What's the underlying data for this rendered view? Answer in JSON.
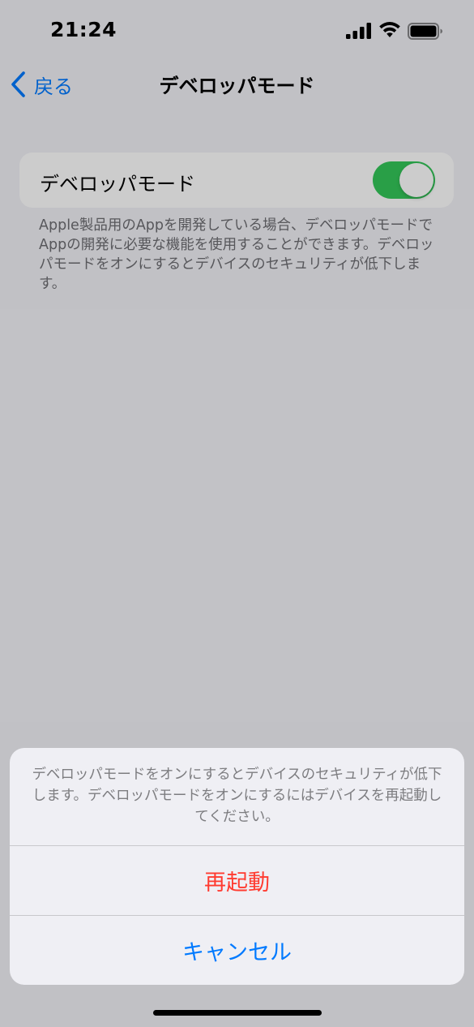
{
  "status_bar": {
    "time": "21:24",
    "icons": [
      "cellular-signal-icon",
      "wifi-icon",
      "battery-icon"
    ]
  },
  "nav": {
    "back_label": "戻る",
    "title": "デベロッパモード"
  },
  "settings": {
    "developer_mode_label": "デベロッパモード",
    "developer_mode_on": true,
    "footer_text": "Apple製品用のAppを開発している場合、デベロッパモードでAppの開発に必要な機能を使用することができます。デベロッパモードをオンにするとデバイスのセキュリティが低下します。"
  },
  "action_sheet": {
    "message": "デベロッパモードをオンにするとデバイスのセキュリティが低下します。デベロッパモードをオンにするにはデバイスを再起動してください。",
    "restart_label": "再起動",
    "cancel_label": "キャンセル"
  },
  "colors": {
    "background": "#f2f2f7",
    "accent": "#007aff",
    "destructive": "#ff3b30",
    "toggle_on": "#34c759"
  }
}
